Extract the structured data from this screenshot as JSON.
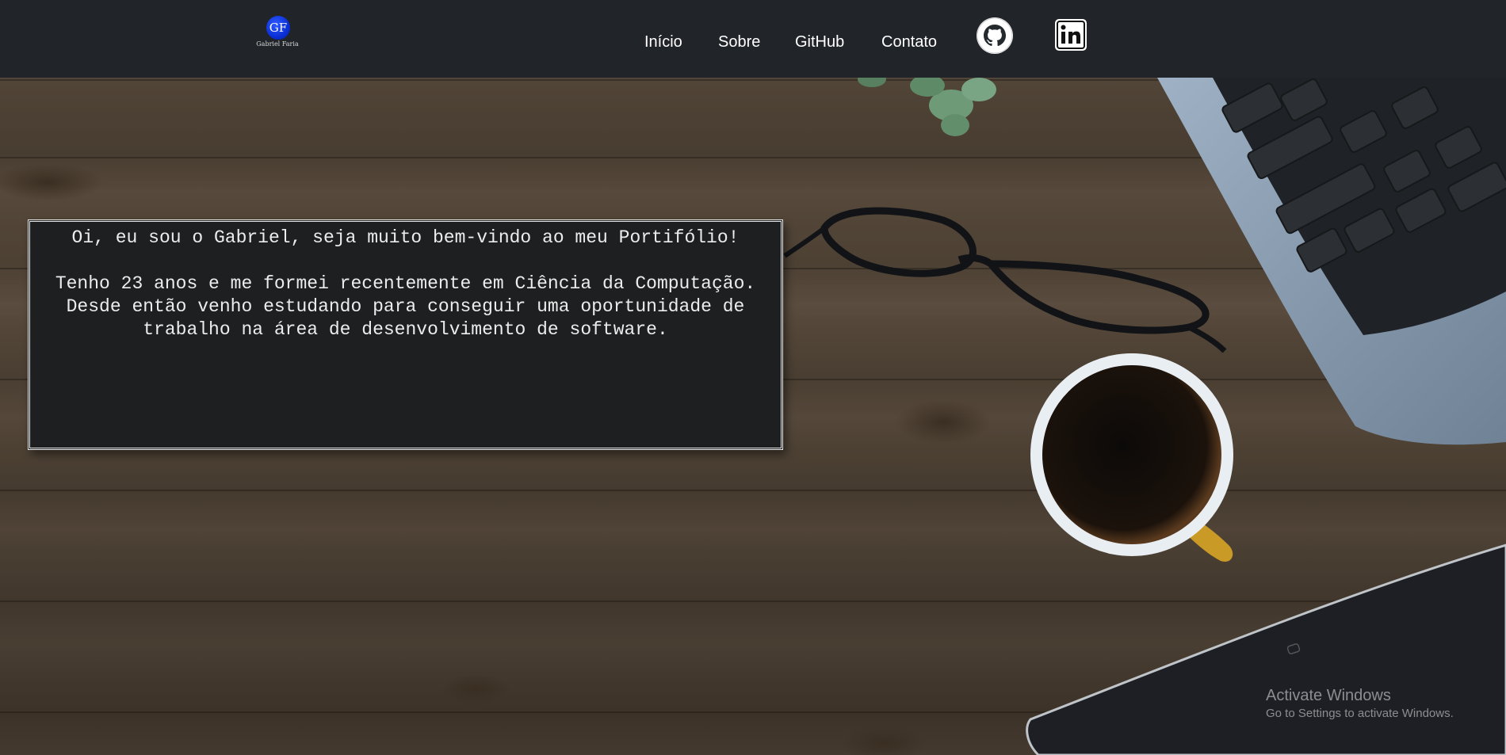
{
  "header": {
    "logo": {
      "initials": "GF",
      "name": "Gabriel Faria"
    },
    "nav": [
      {
        "label": "Início"
      },
      {
        "label": "Sobre"
      },
      {
        "label": "GitHub"
      },
      {
        "label": "Contato"
      }
    ],
    "social": [
      {
        "icon": "github-icon"
      },
      {
        "icon": "linkedin-icon"
      }
    ]
  },
  "intro": {
    "title": "Oi, eu sou o Gabriel, seja muito bem-vindo ao meu Portifólio!",
    "body": "Tenho 23 anos e me formei recentemente em Ciência da Computação. Desde então venho estudando para conseguir uma oportunidade de trabalho na área de desenvolvimento de software."
  },
  "watermark": {
    "title": "Activate Windows",
    "subtitle": "Go to Settings to activate Windows."
  },
  "colors": {
    "header_bg": "#212429",
    "box_bg": "#1e1f20",
    "logo_blue": "#0b2fd6"
  }
}
